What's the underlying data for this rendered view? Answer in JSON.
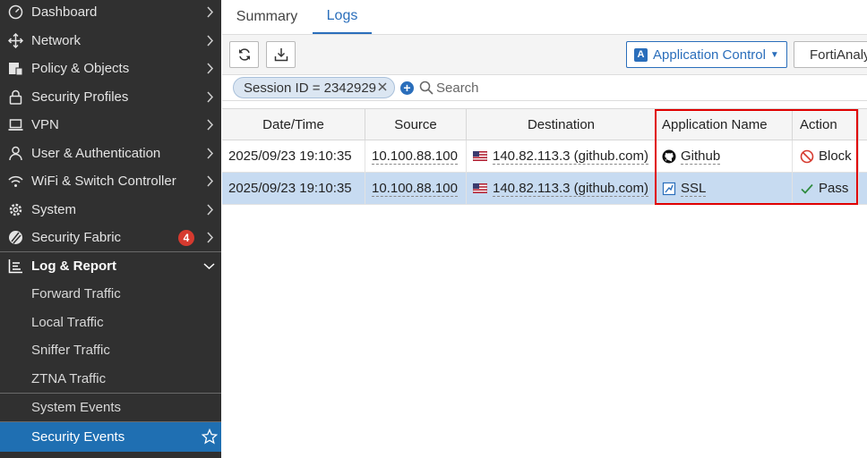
{
  "sidebar": {
    "items": [
      {
        "label": "Dashboard",
        "icon": "dashboard-icon"
      },
      {
        "label": "Network",
        "icon": "network-icon"
      },
      {
        "label": "Policy & Objects",
        "icon": "policy-icon"
      },
      {
        "label": "Security Profiles",
        "icon": "lock-icon"
      },
      {
        "label": "VPN",
        "icon": "laptop-icon"
      },
      {
        "label": "User & Authentication",
        "icon": "user-icon"
      },
      {
        "label": "WiFi & Switch Controller",
        "icon": "wifi-icon"
      },
      {
        "label": "System",
        "icon": "gear-icon"
      },
      {
        "label": "Security Fabric",
        "icon": "fabric-icon",
        "badge": "4"
      },
      {
        "label": "Log & Report",
        "icon": "report-icon"
      }
    ],
    "subitems": [
      "Forward Traffic",
      "Local Traffic",
      "Sniffer Traffic",
      "ZTNA Traffic",
      "System Events",
      "Security Events"
    ]
  },
  "tabs": [
    "Summary",
    "Logs"
  ],
  "toolbar": {
    "app_control_label": "Application Control",
    "app_control_letter": "A",
    "forti_label": "FortiAnalyzer"
  },
  "filter": {
    "chip_text": "Session ID = 2342929",
    "search_placeholder": "Search"
  },
  "table": {
    "headers": [
      "Date/Time",
      "Source",
      "Destination",
      "Application Name",
      "Action"
    ],
    "rows": [
      {
        "datetime": "2025/09/23 19:10:35",
        "source": "10.100.88.100",
        "destination": "140.82.113.3 (github.com)",
        "app": "Github",
        "action": "Block"
      },
      {
        "datetime": "2025/09/23 19:10:35",
        "source": "10.100.88.100",
        "destination": "140.82.113.3 (github.com)",
        "app": "SSL",
        "action": "Pass"
      }
    ]
  },
  "colors": {
    "accent": "#2a6ebb",
    "sidebar_bg": "#303030",
    "selected_row": "#c7dbf1",
    "highlight": "#e00000",
    "block": "#d63a2f",
    "pass": "#2e8b3e"
  }
}
